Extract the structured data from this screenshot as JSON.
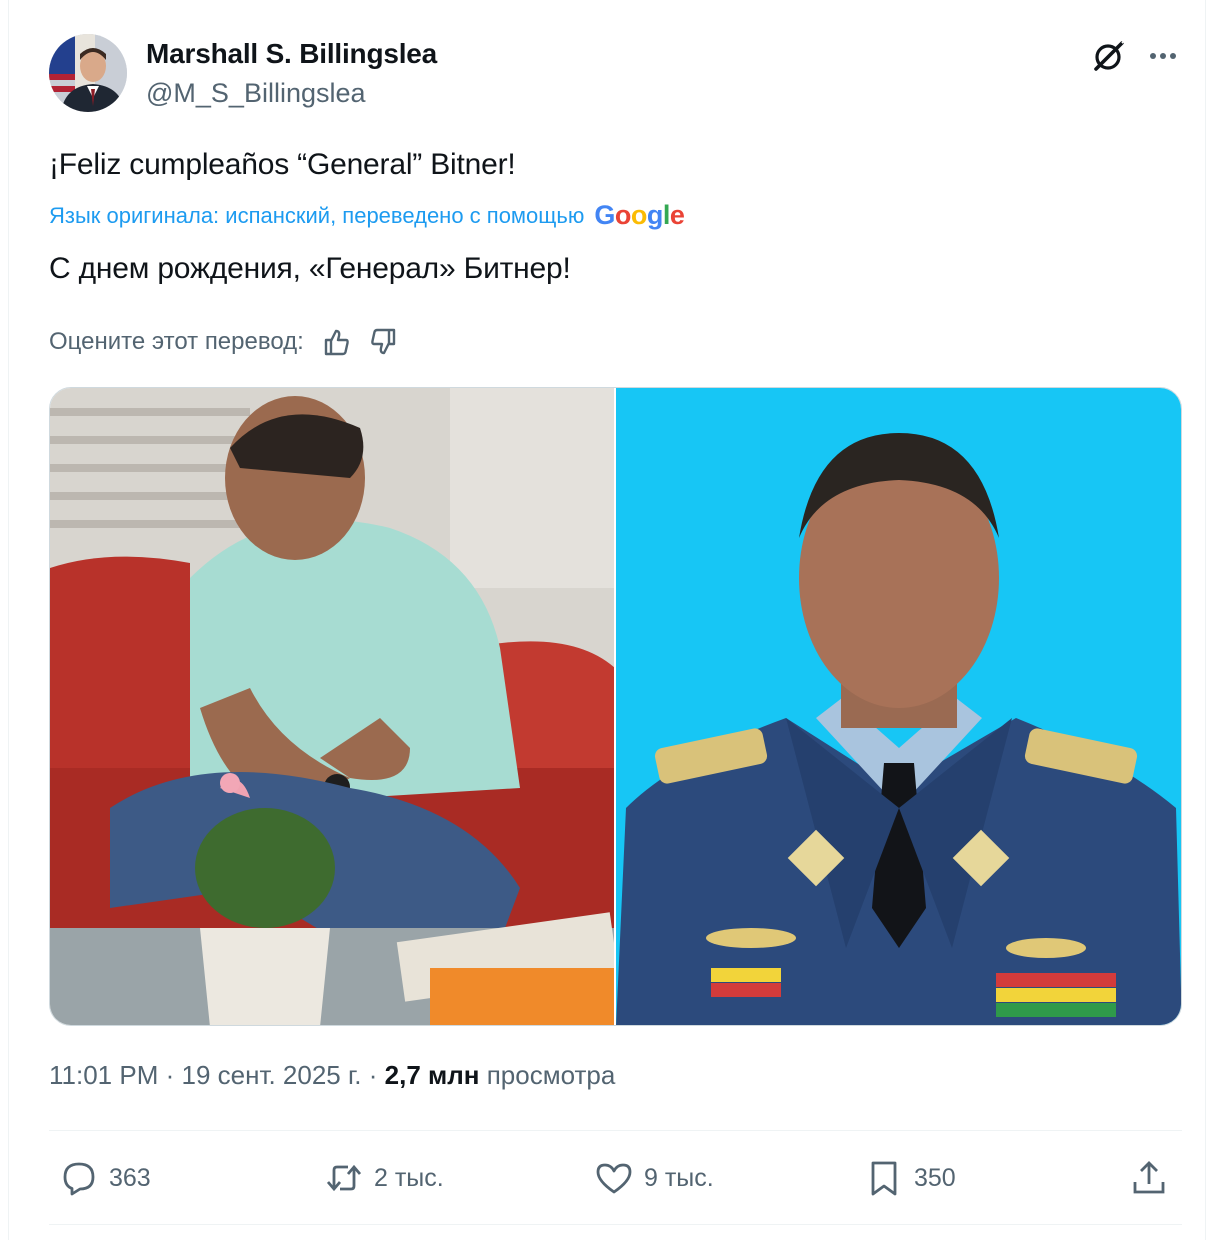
{
  "author": {
    "name": "Marshall S. Billingslea",
    "handle": "@M_S_Billingslea"
  },
  "icons": {
    "grok": "grok-icon",
    "more": "more-icon"
  },
  "tweet": {
    "text": "¡Feliz cumpleaños “General” Bitner!",
    "translation_notice": "Язык оригинала: испанский, переведено с помощью",
    "translation_provider": "Google",
    "translated_text": "С днем рождения, «Генерал» Битнер!",
    "rate_label": "Оцените этот перевод:"
  },
  "meta": {
    "time": "11:01 PM",
    "date": "19 сент. 2025 г.",
    "views_count": "2,7 млн",
    "views_label": "просмотра"
  },
  "actions": {
    "replies": "363",
    "reposts": "2 тыс.",
    "likes": "9 тыс.",
    "bookmarks": "350"
  },
  "colors": {
    "accent": "#1d9bf0",
    "secondary_text": "#536471",
    "primary_text": "#0f1419",
    "photo_right_bg": "#17c6f5"
  }
}
